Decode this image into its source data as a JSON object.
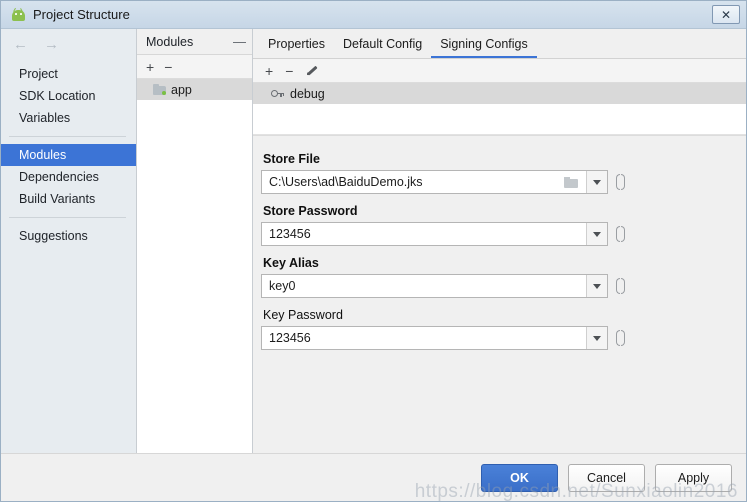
{
  "window": {
    "title": "Project Structure",
    "app_icon": "android-robot-icon",
    "close_label": "✕"
  },
  "nav": {
    "back_icon": "←",
    "forward_icon": "→",
    "items": [
      {
        "label": "Project",
        "selected": false
      },
      {
        "label": "SDK Location",
        "selected": false
      },
      {
        "label": "Variables",
        "selected": false
      },
      {
        "label": "Modules",
        "selected": true
      },
      {
        "label": "Dependencies",
        "selected": false
      },
      {
        "label": "Build Variants",
        "selected": false
      },
      {
        "label": "Suggestions",
        "selected": false
      }
    ]
  },
  "modules_panel": {
    "title": "Modules",
    "collapse_label": "—",
    "add_label": "+",
    "remove_label": "−",
    "items": [
      {
        "label": "app",
        "icon": "module-folder-icon",
        "selected": true
      }
    ]
  },
  "tabs": [
    {
      "label": "Properties",
      "active": false
    },
    {
      "label": "Default Config",
      "active": false
    },
    {
      "label": "Signing Configs",
      "active": true
    }
  ],
  "configs_toolbar": {
    "add_label": "+",
    "remove_label": "−",
    "edit_icon": "pencil-icon"
  },
  "configs_list": [
    {
      "label": "debug",
      "icon": "key-icon",
      "selected": true
    }
  ],
  "form": {
    "fields": [
      {
        "label": "Store File",
        "bold": true,
        "value": "C:\\Users\\ad\\BaiduDemo.jks",
        "has_browse": true
      },
      {
        "label": "Store Password",
        "bold": true,
        "value": "123456",
        "has_browse": false
      },
      {
        "label": "Key Alias",
        "bold": true,
        "value": "key0",
        "has_browse": false
      },
      {
        "label": "Key Password",
        "bold": false,
        "value": "123456",
        "has_browse": false
      }
    ]
  },
  "footer": {
    "ok_label": "OK",
    "cancel_label": "Cancel",
    "apply_label": "Apply"
  },
  "watermark": "https://blog.csdn.net/Sunxiaolin2016",
  "colors": {
    "accent": "#3c74d6",
    "titlebar": "#cddbe8",
    "selection_gray": "#d9d9d9",
    "panel_bg": "#f0f0f0"
  }
}
